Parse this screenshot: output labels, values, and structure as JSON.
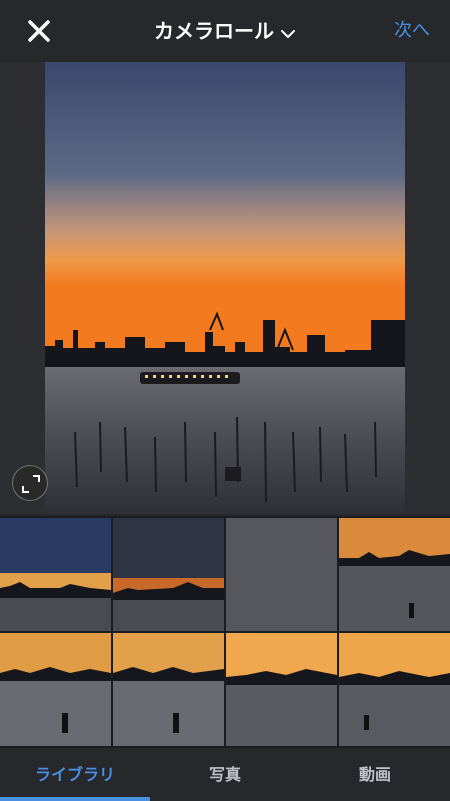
{
  "header": {
    "title": "カメラロール",
    "next_label": "次へ",
    "close_icon": "close-icon",
    "dropdown_icon": "chevron-down-icon"
  },
  "preview": {
    "alt": "sunset-bay-skyline-photo",
    "expand_icon": "expand-icon"
  },
  "grid": {
    "selected_index": 1,
    "item_count": 8
  },
  "tabs": [
    {
      "label": "ライブラリ",
      "active": true
    },
    {
      "label": "写真",
      "active": false
    },
    {
      "label": "動画",
      "active": false
    }
  ],
  "colors": {
    "accent": "#4a90e2",
    "background": "#26282c"
  }
}
